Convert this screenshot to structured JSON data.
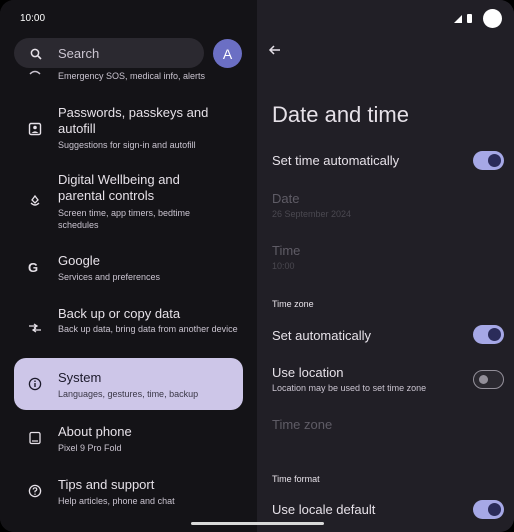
{
  "status_bar": {
    "time": "10:00"
  },
  "search": {
    "label": "Search"
  },
  "avatar": {
    "initial": "A"
  },
  "settings_list": {
    "items": [
      {
        "title": "",
        "subtitle": "Emergency SOS, medical info, alerts",
        "icon": "medical-icon"
      },
      {
        "title": "Passwords, passkeys and autofill",
        "subtitle": "Suggestions for sign-in and autofill",
        "icon": "account-box-icon"
      },
      {
        "title": "Digital Wellbeing and parental controls",
        "subtitle": "Screen time, app timers, bedtime schedules",
        "icon": "wellbeing-icon"
      },
      {
        "title": "Google",
        "subtitle": "Services and preferences",
        "icon": "google-icon"
      },
      {
        "title": "Back up or copy data",
        "subtitle": "Back up data, bring data from another device",
        "icon": "sync-arrows-icon"
      },
      {
        "title": "System",
        "subtitle": "Languages, gestures, time, backup",
        "icon": "info-icon",
        "selected": true
      },
      {
        "title": "About phone",
        "subtitle": "Pixel 9 Pro Fold",
        "icon": "phone-icon"
      },
      {
        "title": "Tips and support",
        "subtitle": "Help articles, phone and chat",
        "icon": "help-icon"
      }
    ]
  },
  "detail": {
    "title": "Date and time",
    "set_time_auto": {
      "label": "Set time automatically",
      "on": true
    },
    "date": {
      "label": "Date",
      "value": "26 September 2024"
    },
    "time": {
      "label": "Time",
      "value": "10:00"
    },
    "time_zone_section": "Time zone",
    "set_tz_auto": {
      "label": "Set automatically",
      "on": true
    },
    "use_location": {
      "label": "Use location",
      "subtitle": "Location may be used to set time zone",
      "on": false
    },
    "time_zone": {
      "label": "Time zone"
    },
    "time_format_section": "Time format",
    "use_locale_default": {
      "label": "Use locale default",
      "on": true
    }
  },
  "colors": {
    "accent": "#a6a8e6",
    "selected_bg": "#cdc6e8",
    "avatar_bg": "#6b6fc4"
  }
}
